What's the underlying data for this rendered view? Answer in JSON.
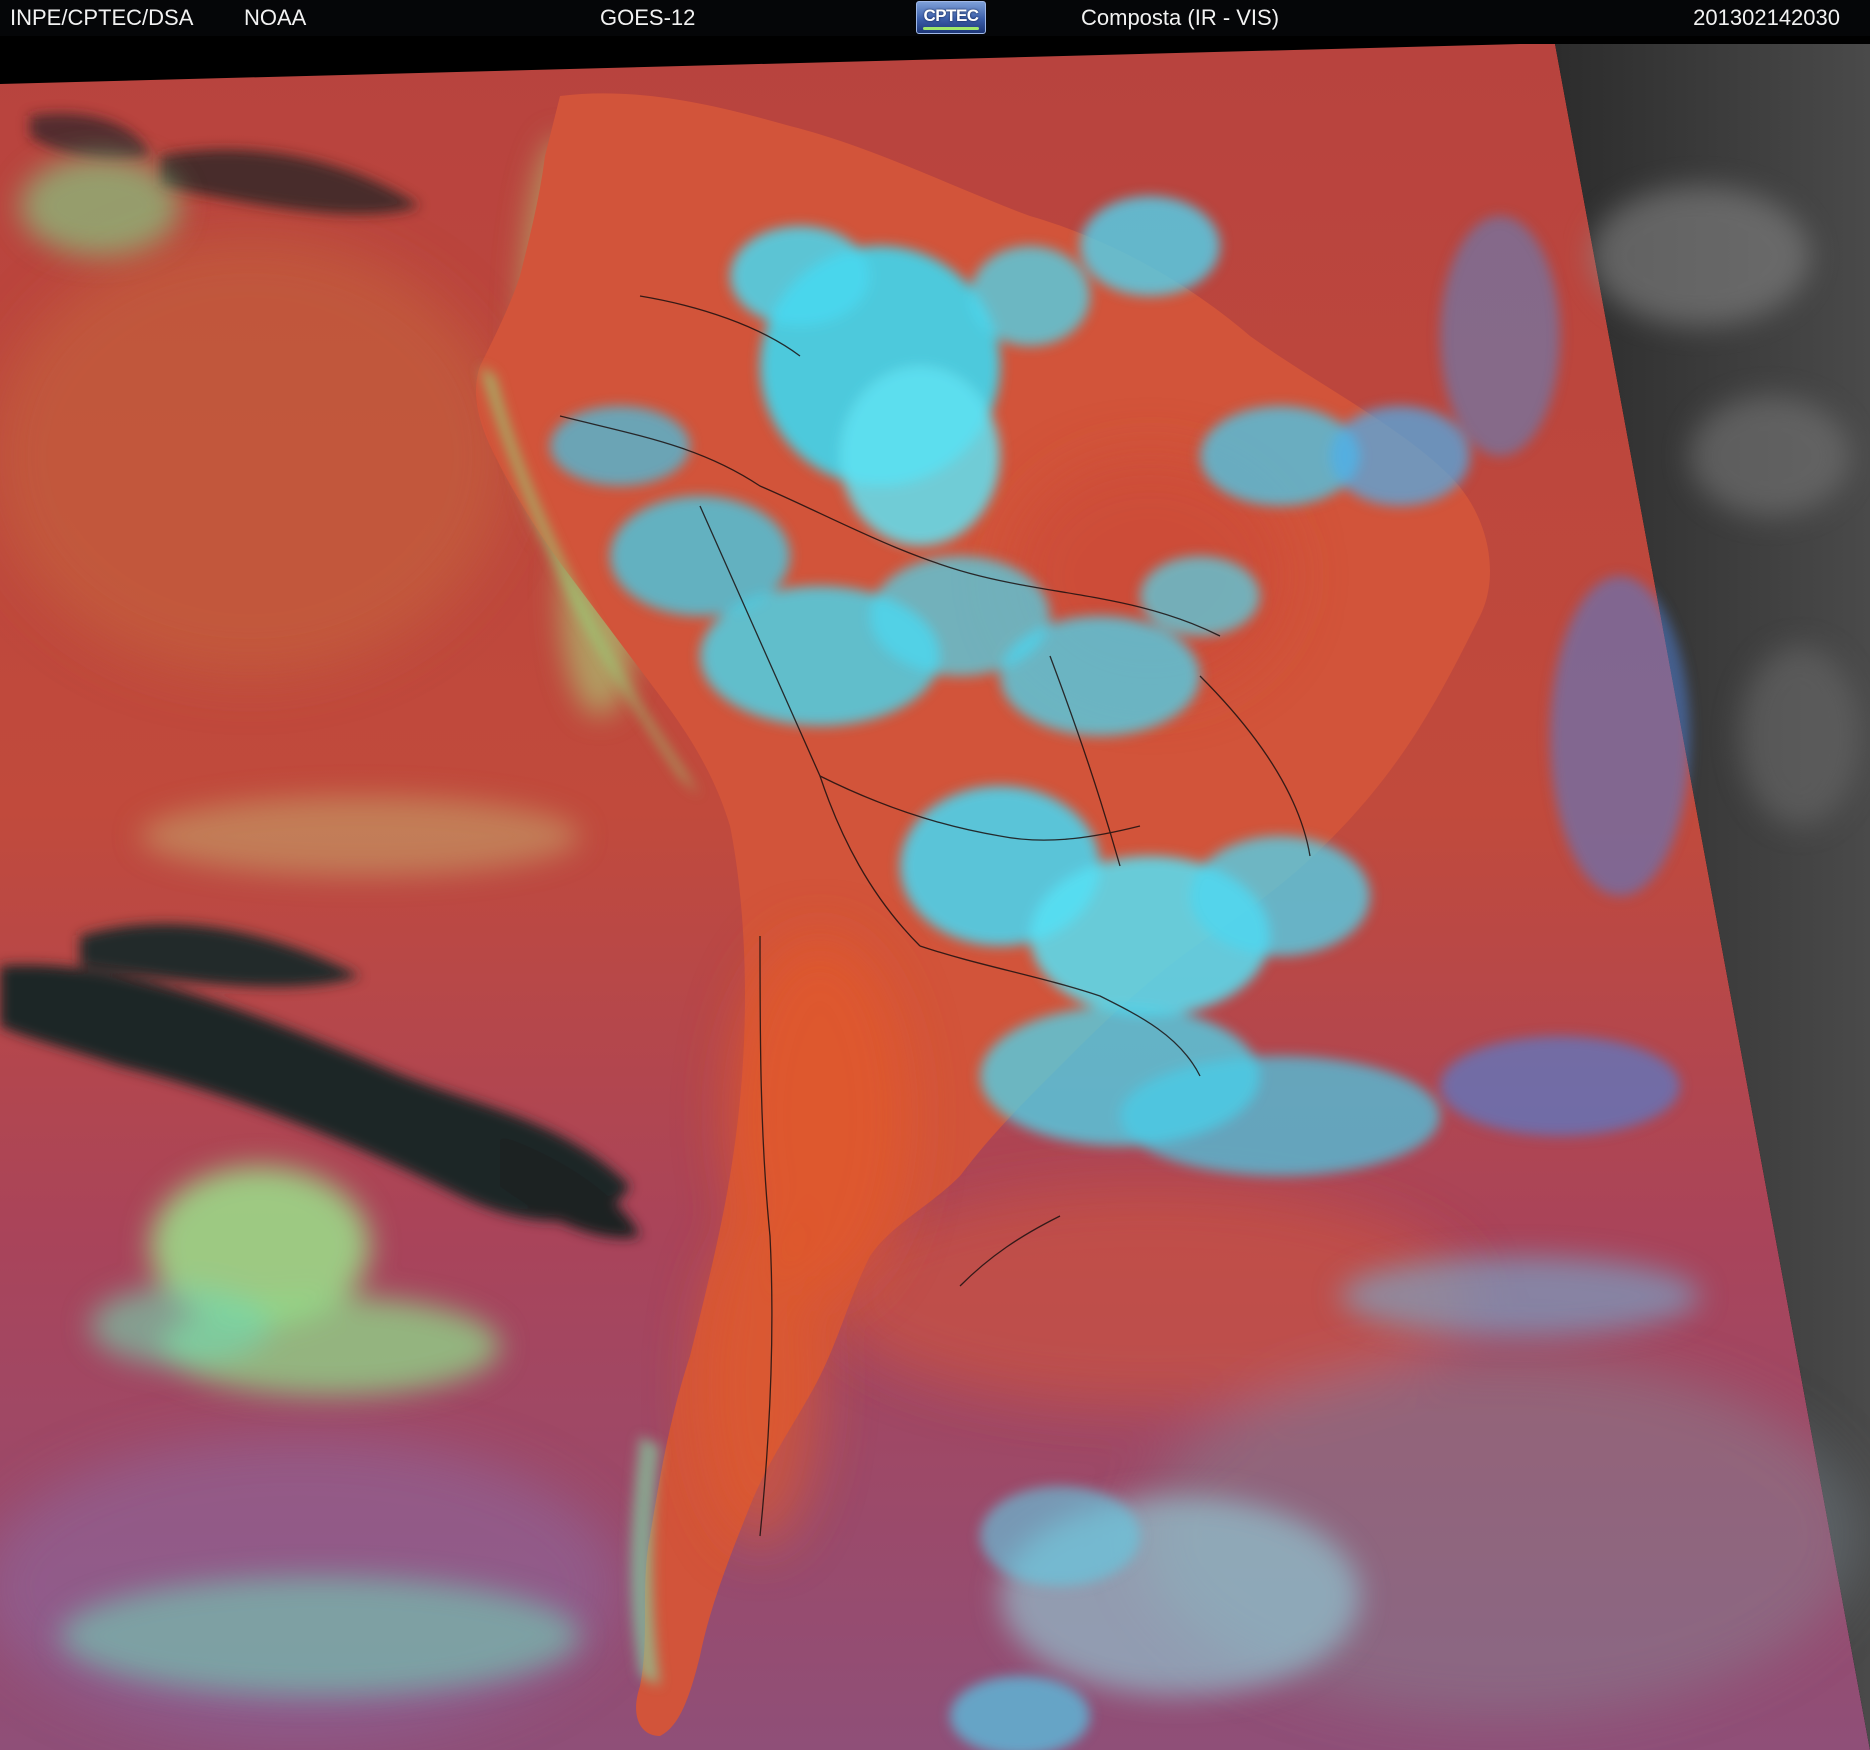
{
  "header": {
    "org": "INPE/CPTEC/DSA",
    "agency": "NOAA",
    "satellite": "GOES-12",
    "logo_text": "CPTEC",
    "product": "Composta (IR - VIS)",
    "timestamp": "201302142030"
  },
  "colors": {
    "ocean_red": "#b8433e",
    "land_orange": "#d9552d",
    "cold_cloud_cyan": "#3fd6ee",
    "low_cloud_green": "#8fe07e",
    "clear_dark": "#1e2426",
    "night_gray": "#3a3a3a"
  }
}
